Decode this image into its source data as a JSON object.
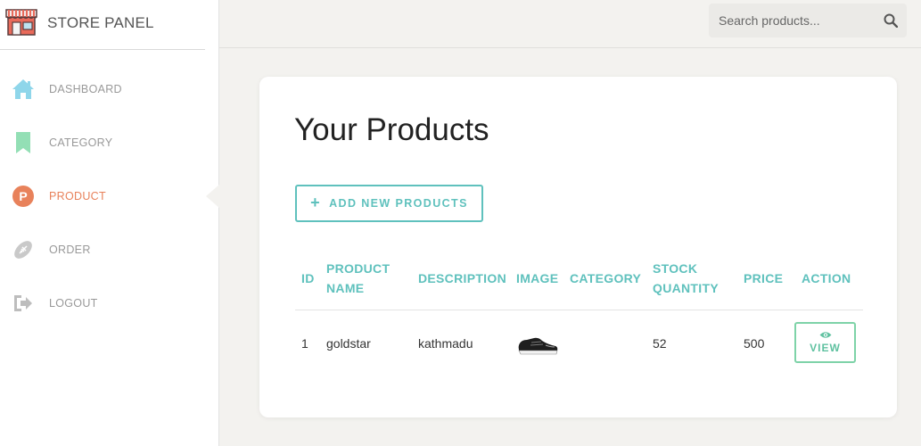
{
  "sidebar": {
    "brand": {
      "title": "STORE PANEL",
      "icon": "store-icon"
    },
    "items": [
      {
        "label": "DASHBOARD",
        "icon": "home-icon",
        "color": "#8fd6ea",
        "active": false
      },
      {
        "label": "CATEGORY",
        "icon": "bookmark-icon",
        "color": "#93dfb5",
        "active": false
      },
      {
        "label": "PRODUCT",
        "icon": "p-circle-icon",
        "color": "#e8825b",
        "active": true
      },
      {
        "label": "ORDER",
        "icon": "football-icon",
        "color": "#c9c9c9",
        "active": false
      },
      {
        "label": "LOGOUT",
        "icon": "logout-icon",
        "color": "#bdbdbd",
        "active": false
      }
    ]
  },
  "search": {
    "placeholder": "Search products...",
    "icon": "search-icon"
  },
  "main": {
    "title": "Your Products",
    "add_button": {
      "label": "ADD NEW PRODUCTS",
      "icon": "plus-icon"
    },
    "table": {
      "columns": [
        [
          "ID"
        ],
        [
          "PRODUCT",
          "NAME"
        ],
        [
          "DESCRIPTION"
        ],
        [
          "IMAGE"
        ],
        [
          "CATEGORY"
        ],
        [
          "STOCK",
          "QUANTITY"
        ],
        [
          "PRICE"
        ],
        [
          "ACTION"
        ]
      ],
      "rows": [
        {
          "id": "1",
          "name": "goldstar",
          "description": "kathmadu",
          "image": "shoe-image",
          "category": "",
          "stock": "52",
          "price": "500",
          "action": {
            "label": "VIEW",
            "icon": "eye-icon"
          }
        }
      ]
    }
  },
  "colors": {
    "accent": "#5fc1bd",
    "active": "#e8825b",
    "view": "#7ed3a8",
    "background": "#f3f2ef"
  }
}
